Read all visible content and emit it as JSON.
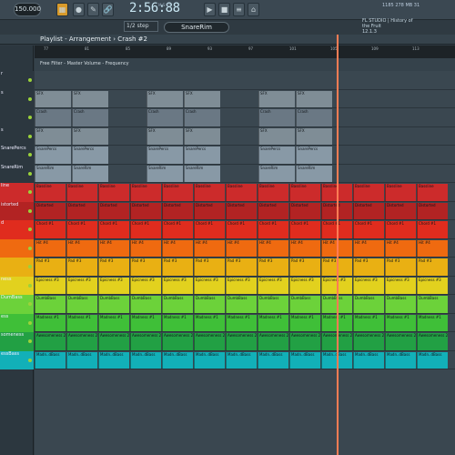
{
  "toolbar": {
    "tempo": "150.000",
    "clock": "2:56:88",
    "clock_sub": "M:S:CS",
    "step": "1/2 step",
    "channel": "SnareRim",
    "cpu": "1185  278 MB  31"
  },
  "hint": {
    "line1": "FL STUDIO | History of",
    "line2": "the Fruit",
    "line3": "12.1.3"
  },
  "title": "Playlist - Arrangement › Crash #2",
  "ruler": [
    "77",
    "81",
    "85",
    "89",
    "93",
    "97",
    "101",
    "105",
    "109",
    "113"
  ],
  "automation": "Free Filter - Master Volume - Frequency",
  "tracks": [
    {
      "name": "r",
      "clip": "",
      "color": "#4c5a63"
    },
    {
      "name": "s",
      "clip": "SFX",
      "color": "#7f8d96"
    },
    {
      "name": "",
      "clip": "Crash",
      "color": "#6a7884"
    },
    {
      "name": "s",
      "clip": "SFX",
      "color": "#7f8d96"
    },
    {
      "name": "SnarePercs",
      "clip": "SnarePercs",
      "color": "#8899a6"
    },
    {
      "name": "SnareRim",
      "clip": "SnareRim",
      "color": "#8899a6"
    },
    {
      "name": "line",
      "clip": "Bassline",
      "color": "#cc2b2b"
    },
    {
      "name": "istorted",
      "clip": "Distorted",
      "color": "#b22323"
    },
    {
      "name": "d",
      "clip": "Chord #1",
      "color": "#e02c1e"
    },
    {
      "name": "",
      "clip": "Hit #4",
      "color": "#ef6a10"
    },
    {
      "name": "",
      "clip": "Pad #3",
      "color": "#e9b013"
    },
    {
      "name": "ness",
      "clip": "Epicness #3",
      "color": "#e2d11e"
    },
    {
      "name": "DumBass",
      "clip": "DumbBass",
      "color": "#6cd23a"
    },
    {
      "name": "ess",
      "clip": "Madness #1",
      "color": "#3fbf38"
    },
    {
      "name": "someness",
      "clip": "Awesomeness 2",
      "color": "#22a044"
    },
    {
      "name": "essBass",
      "clip": "Madn..dBass",
      "color": "#12b0b8"
    }
  ]
}
